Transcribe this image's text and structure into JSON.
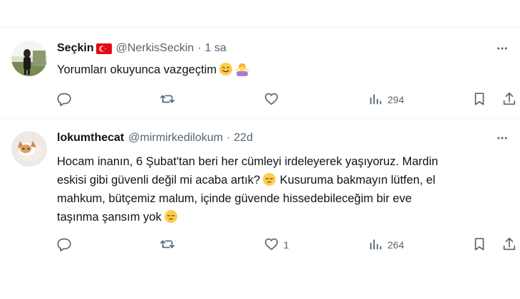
{
  "tweets": [
    {
      "name": "Seçkin",
      "handle": "@NerkisSeckin",
      "separator": "·",
      "time": "1 sa",
      "text_lines": [
        "Yorumları okuyunca vazgeçtim"
      ],
      "emojis": [
        "smiling-face-emoji",
        "woman-shrugging-emoji"
      ],
      "counts": {
        "reply": "",
        "retweet": "",
        "like": "",
        "views": "294"
      }
    },
    {
      "name": "lokumthecat",
      "handle": "@mirmirkedilokum",
      "separator": "·",
      "time": "22d",
      "text_lines": [
        "Hocam inanın, 6 Şubat'tan beri her cümleyi irdeleyerek yaşıyoruz. Mardin",
        "eskisi gibi güvenli değil mi acaba artık?",
        "Kusuruma bakmayın lütfen, el",
        "mahkum, bütçemiz malum, içinde güvende hissedebileceğim bir eve",
        "taşınma şansım yok"
      ],
      "emojis": [
        "pensive-face-emoji"
      ],
      "counts": {
        "reply": "",
        "retweet": "",
        "like": "1",
        "views": "264"
      }
    }
  ],
  "colors": {
    "text": "#0f1419",
    "secondary": "#536471",
    "divider": "#eff3f4"
  }
}
